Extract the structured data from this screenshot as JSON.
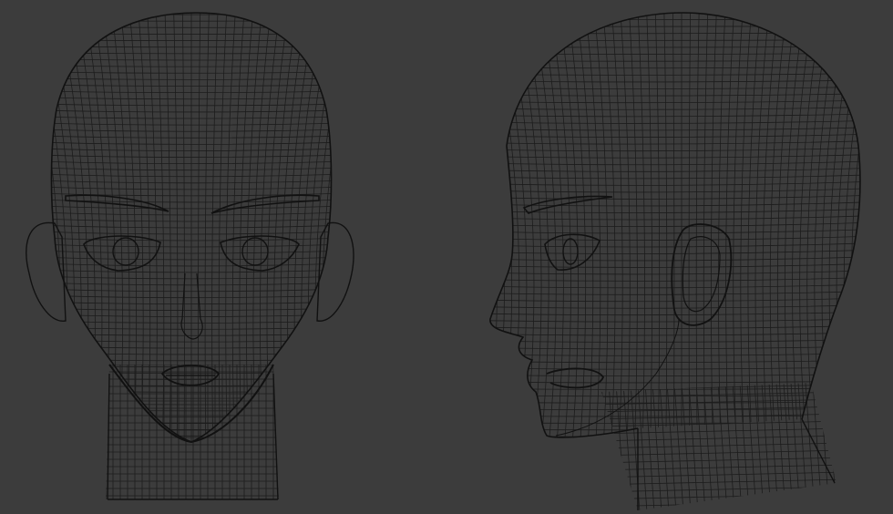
{
  "scene": {
    "background_color": "#3c3c3c",
    "wire_color": "#111111",
    "wire_color_soft": "#1c1c1c",
    "views": [
      {
        "id": "front",
        "label": ""
      },
      {
        "id": "side",
        "label": ""
      }
    ]
  }
}
